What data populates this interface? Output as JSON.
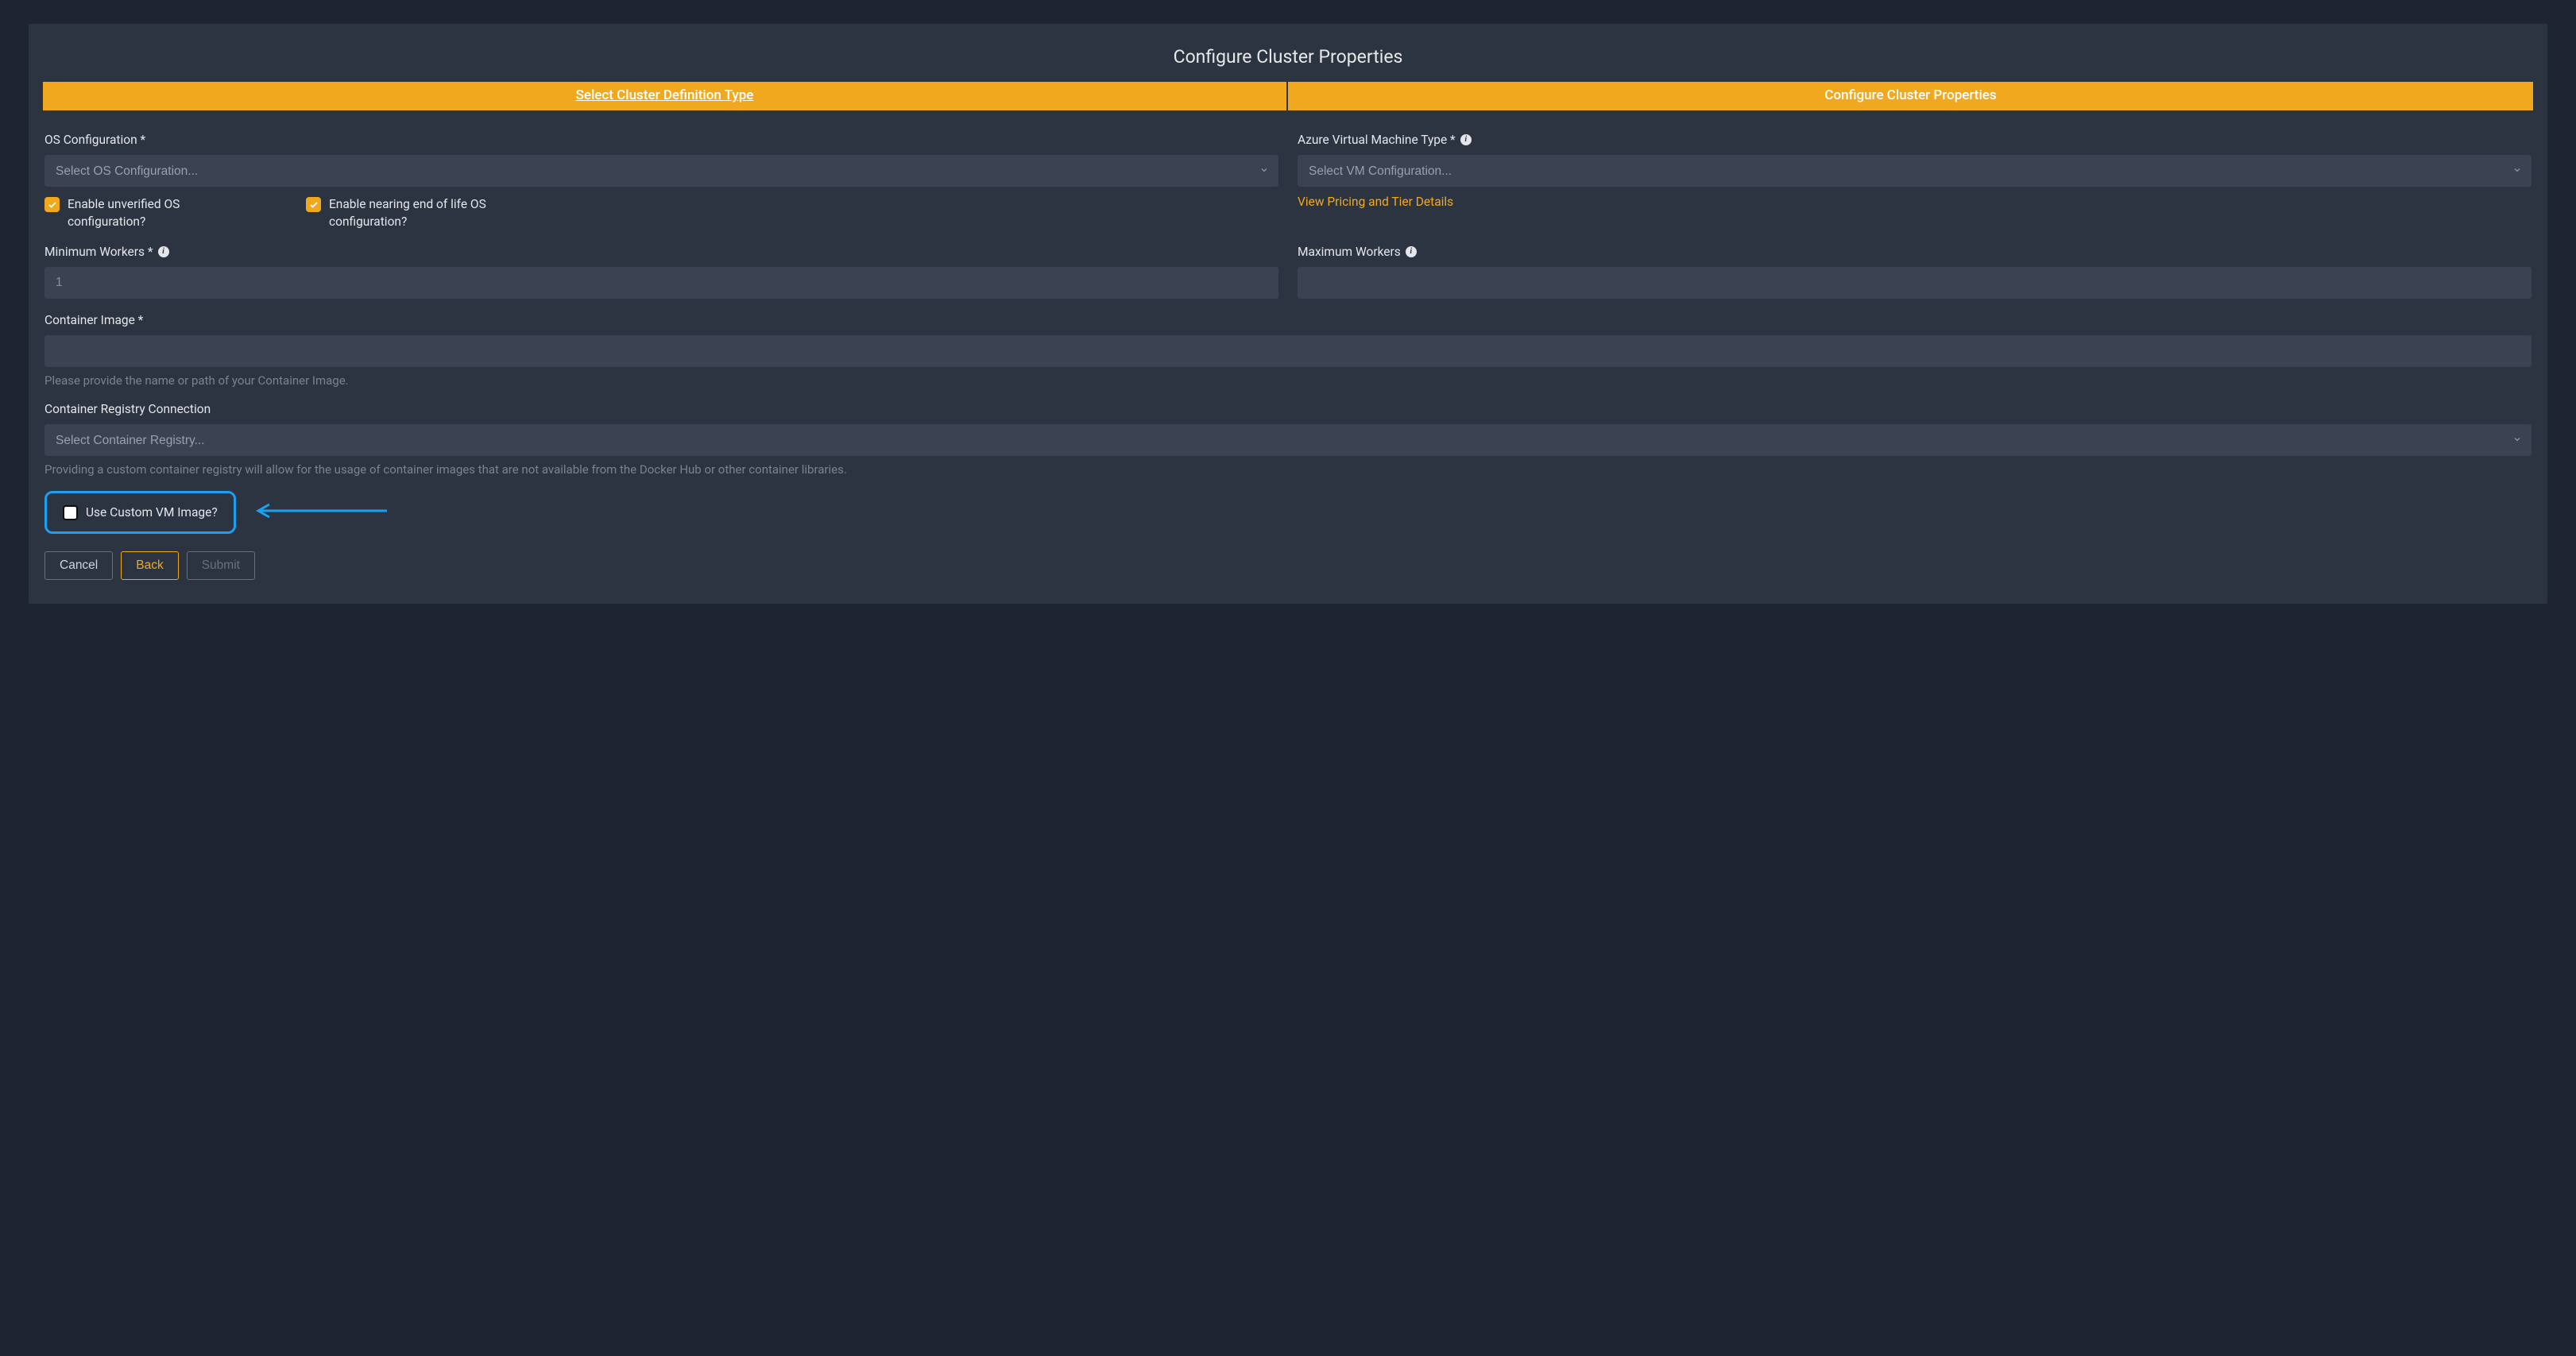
{
  "page": {
    "title": "Configure Cluster Properties"
  },
  "stepper": {
    "step1": "Select Cluster Definition Type",
    "step2": "Configure Cluster Properties"
  },
  "os_config": {
    "label": "OS Configuration *",
    "placeholder": "Select OS Configuration...",
    "cb_unverified": "Enable unverified OS configuration?",
    "cb_eol": "Enable nearing end of life OS configuration?"
  },
  "vm_type": {
    "label": "Azure Virtual Machine Type * ",
    "placeholder": "Select VM Configuration...",
    "pricing_link": "View Pricing and Tier Details"
  },
  "min_workers": {
    "label": "Minimum Workers * ",
    "placeholder": "1",
    "value": ""
  },
  "max_workers": {
    "label": "Maximum Workers ",
    "value": ""
  },
  "container_image": {
    "label": "Container Image *",
    "value": "",
    "helper": "Please provide the name or path of your Container Image."
  },
  "container_registry": {
    "label": "Container Registry Connection",
    "placeholder": "Select Container Registry...",
    "helper": "Providing a custom container registry will allow for the usage of container images that are not available from the Docker Hub or other container libraries."
  },
  "custom_vm": {
    "label": "Use Custom VM Image?"
  },
  "buttons": {
    "cancel": "Cancel",
    "back": "Back",
    "submit": "Submit"
  }
}
